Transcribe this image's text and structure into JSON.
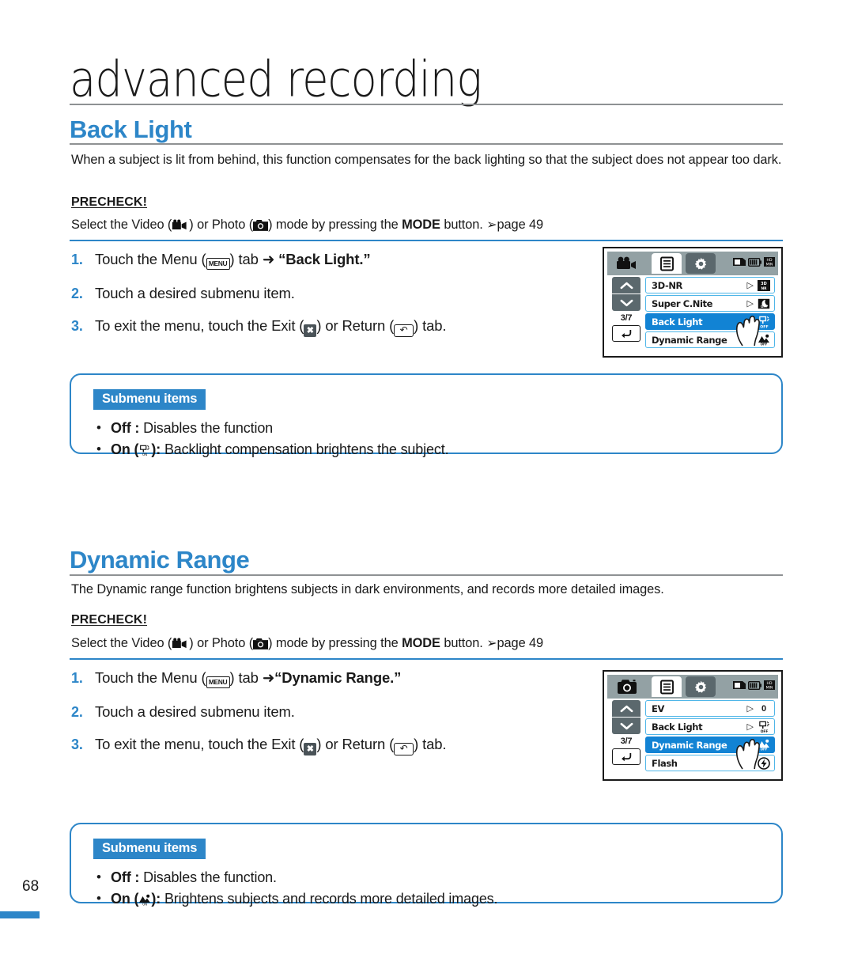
{
  "chapter": {
    "title": "advanced recording"
  },
  "page": {
    "number": "68"
  },
  "sections": [
    {
      "id": "back-light",
      "heading": "Back Light",
      "intro": "When a subject is lit from behind, this function compensates for the back lighting so that the subject does not appear too dark.",
      "precheck_label": "PRECHECK!",
      "precheck_before": "Select the Video (",
      "precheck_mid": ") or Photo (",
      "precheck_after": ") mode by pressing the ",
      "precheck_mode": "MODE",
      "precheck_end": " button. ",
      "precheck_page": "page 49",
      "steps": [
        {
          "num": "1.",
          "pre": "Touch the Menu (",
          "menu_icon_label": "MENU",
          "mid": ") tab ",
          "arrow": "➜",
          "target": "“Back Light.”"
        },
        {
          "num": "2.",
          "text": "Touch a desired submenu item."
        },
        {
          "num": "3.",
          "pre": "To exit the menu, touch the Exit (",
          "mid": ") or Return (",
          "post": ") tab."
        }
      ],
      "submenu": {
        "badge": "Submenu items",
        "items": [
          {
            "name": "Off",
            "sep": " : ",
            "desc": "Disables the function",
            "icon": null
          },
          {
            "name": "On",
            "sep": "): ",
            "desc": "Backlight compensation brightens the subject.",
            "icon": "backlight-icon"
          }
        ]
      },
      "lcd": {
        "mode_icon": "video-camera-icon",
        "tabs": [
          "video-mode-tab",
          "menu-tab",
          "settings-tab"
        ],
        "status_icons": [
          "memory-card-icon",
          "battery-icon",
          "record-quality-icon"
        ],
        "page_indicator": "3/7",
        "nav": {
          "up": "chevron-up-icon",
          "down": "chevron-down-icon",
          "return": "return-icon"
        },
        "rows": [
          {
            "label": "3D-NR",
            "value_icon": "3dnr-icon",
            "selected": false
          },
          {
            "label": "Super C.Nite",
            "value_icon": "supercnite-icon",
            "selected": false
          },
          {
            "label": "Back Light",
            "value_icon": "backlight-off-icon",
            "selected": true
          },
          {
            "label": "Dynamic Range",
            "value_icon": "dynamicrange-icon",
            "selected": false
          }
        ]
      }
    },
    {
      "id": "dynamic-range",
      "heading": "Dynamic Range",
      "intro": "The Dynamic range function brightens subjects in dark environments, and records more detailed images.",
      "precheck_label": "PRECHECK!",
      "precheck_before": "Select the Video (",
      "precheck_mid": ") or Photo (",
      "precheck_after": ") mode by pressing the ",
      "precheck_mode": "MODE",
      "precheck_end": " button. ",
      "precheck_page": "page 49",
      "steps": [
        {
          "num": "1.",
          "pre": "Touch the Menu (",
          "menu_icon_label": "MENU",
          "mid": ") tab ",
          "arrow": "➜",
          "target": "“Dynamic Range.”"
        },
        {
          "num": "2.",
          "text": "Touch a desired submenu item."
        },
        {
          "num": "3.",
          "pre": "To exit the menu, touch the Exit (",
          "mid": ") or Return (",
          "post": ") tab."
        }
      ],
      "submenu": {
        "badge": "Submenu items",
        "items": [
          {
            "name": "Off",
            "sep": " : ",
            "desc": "Disables the function.",
            "icon": null
          },
          {
            "name": "On",
            "sep": "): ",
            "desc": "Brightens subjects and records more detailed images.",
            "icon": "dynamicrange-icon"
          }
        ]
      },
      "lcd": {
        "mode_icon": "photo-camera-icon",
        "tabs": [
          "photo-mode-tab",
          "menu-tab",
          "settings-tab"
        ],
        "status_icons": [
          "memory-card-icon",
          "battery-icon",
          "record-quality-icon"
        ],
        "page_indicator": "3/7",
        "nav": {
          "up": "chevron-up-icon",
          "down": "chevron-down-icon",
          "return": "return-icon"
        },
        "rows": [
          {
            "label": "EV",
            "value_text": "0",
            "selected": false
          },
          {
            "label": "Back Light",
            "value_icon": "backlight-off-icon",
            "selected": false
          },
          {
            "label": "Dynamic Range",
            "value_icon": "dynamicrange-icon",
            "selected": true
          },
          {
            "label": "Flash",
            "value_icon": "flash-icon",
            "selected": false
          }
        ]
      }
    }
  ],
  "colors": {
    "accent_blue": "#2d86c8",
    "lcd_select_blue": "#1283d4",
    "lcd_row_border": "#4fb6e8",
    "rule_gray": "#8e9193",
    "lcd_chrome": "#93a1a4",
    "lcd_dark": "#5b686d"
  }
}
